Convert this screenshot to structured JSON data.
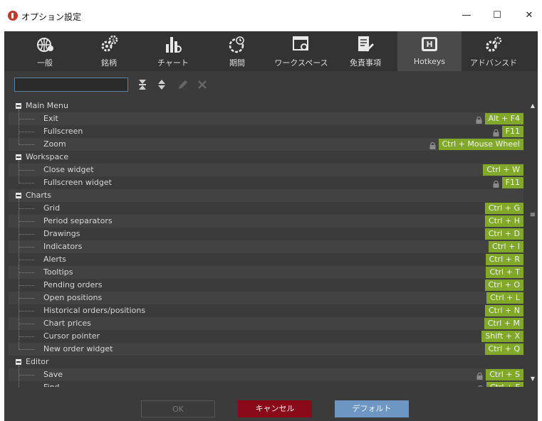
{
  "window": {
    "title": "オプション設定",
    "minimize": "—",
    "maximize": "☐",
    "close": "✕"
  },
  "tabs": [
    {
      "id": "general",
      "label": "一般",
      "icon": "globe-gear-icon",
      "active": false
    },
    {
      "id": "symbols",
      "label": "銘柄",
      "icon": "dollar-gear-icon",
      "active": false
    },
    {
      "id": "chart",
      "label": "チャート",
      "icon": "bar-chart-gear-icon",
      "active": false
    },
    {
      "id": "period",
      "label": "期間",
      "icon": "clock-gear-icon",
      "active": false
    },
    {
      "id": "workspace",
      "label": "ワークスペース",
      "icon": "window-gear-icon",
      "active": false
    },
    {
      "id": "disclaimer",
      "label": "免責事項",
      "icon": "document-pen-icon",
      "active": false
    },
    {
      "id": "hotkeys",
      "label": "Hotkeys",
      "icon": "h-key-icon",
      "active": true
    },
    {
      "id": "advanced",
      "label": "アドバンスド",
      "icon": "gears-icon",
      "active": false
    }
  ],
  "search": {
    "value": "",
    "placeholder": ""
  },
  "toolbar": {
    "expand_all": "expand-all-icon",
    "collapse_all": "collapse-all-icon",
    "edit": "pencil-icon",
    "delete": "x-icon"
  },
  "tree": [
    {
      "type": "group",
      "label": "Main Menu"
    },
    {
      "type": "item",
      "label": "Exit",
      "key": "Alt + F4",
      "locked": true
    },
    {
      "type": "item",
      "label": "Fullscreen",
      "key": "F11",
      "locked": true
    },
    {
      "type": "item",
      "label": "Zoom",
      "key": "Ctrl + Mouse Wheel",
      "locked": true
    },
    {
      "type": "group",
      "label": "Workspace"
    },
    {
      "type": "item",
      "label": "Close widget",
      "key": "Ctrl + W",
      "locked": false
    },
    {
      "type": "item",
      "label": "Fullscreen widget",
      "key": "F11",
      "locked": true
    },
    {
      "type": "group",
      "label": "Charts"
    },
    {
      "type": "item",
      "label": "Grid",
      "key": "Ctrl + G",
      "locked": false
    },
    {
      "type": "item",
      "label": "Period separators",
      "key": "Ctrl + H",
      "locked": false
    },
    {
      "type": "item",
      "label": "Drawings",
      "key": "Ctrl + D",
      "locked": false
    },
    {
      "type": "item",
      "label": "Indicators",
      "key": "Ctrl + I",
      "locked": false
    },
    {
      "type": "item",
      "label": "Alerts",
      "key": "Ctrl + R",
      "locked": false
    },
    {
      "type": "item",
      "label": "Tooltips",
      "key": "Ctrl + T",
      "locked": false
    },
    {
      "type": "item",
      "label": "Pending orders",
      "key": "Ctrl + O",
      "locked": false
    },
    {
      "type": "item",
      "label": "Open positions",
      "key": "Ctrl + L",
      "locked": false
    },
    {
      "type": "item",
      "label": "Historical orders/positions",
      "key": "Ctrl + N",
      "locked": false
    },
    {
      "type": "item",
      "label": "Chart prices",
      "key": "Ctrl + M",
      "locked": false
    },
    {
      "type": "item",
      "label": "Cursor pointer",
      "key": "Shift + X",
      "locked": false
    },
    {
      "type": "item",
      "label": "New order widget",
      "key": "Ctrl + Q",
      "locked": false
    },
    {
      "type": "group",
      "label": "Editor"
    },
    {
      "type": "item",
      "label": "Save",
      "key": "Ctrl + S",
      "locked": true
    },
    {
      "type": "item",
      "label": "Find",
      "key": "Ctrl + F",
      "locked": true
    }
  ],
  "footer": {
    "ok_label": "OK",
    "cancel_label": "キャンセル",
    "default_label": "デフォルト"
  },
  "colors": {
    "key_bg": "#82a82a",
    "cancel_bg": "#8b0a1a",
    "default_bg": "#6d96c2",
    "panel_bg": "#3b3b3b"
  }
}
